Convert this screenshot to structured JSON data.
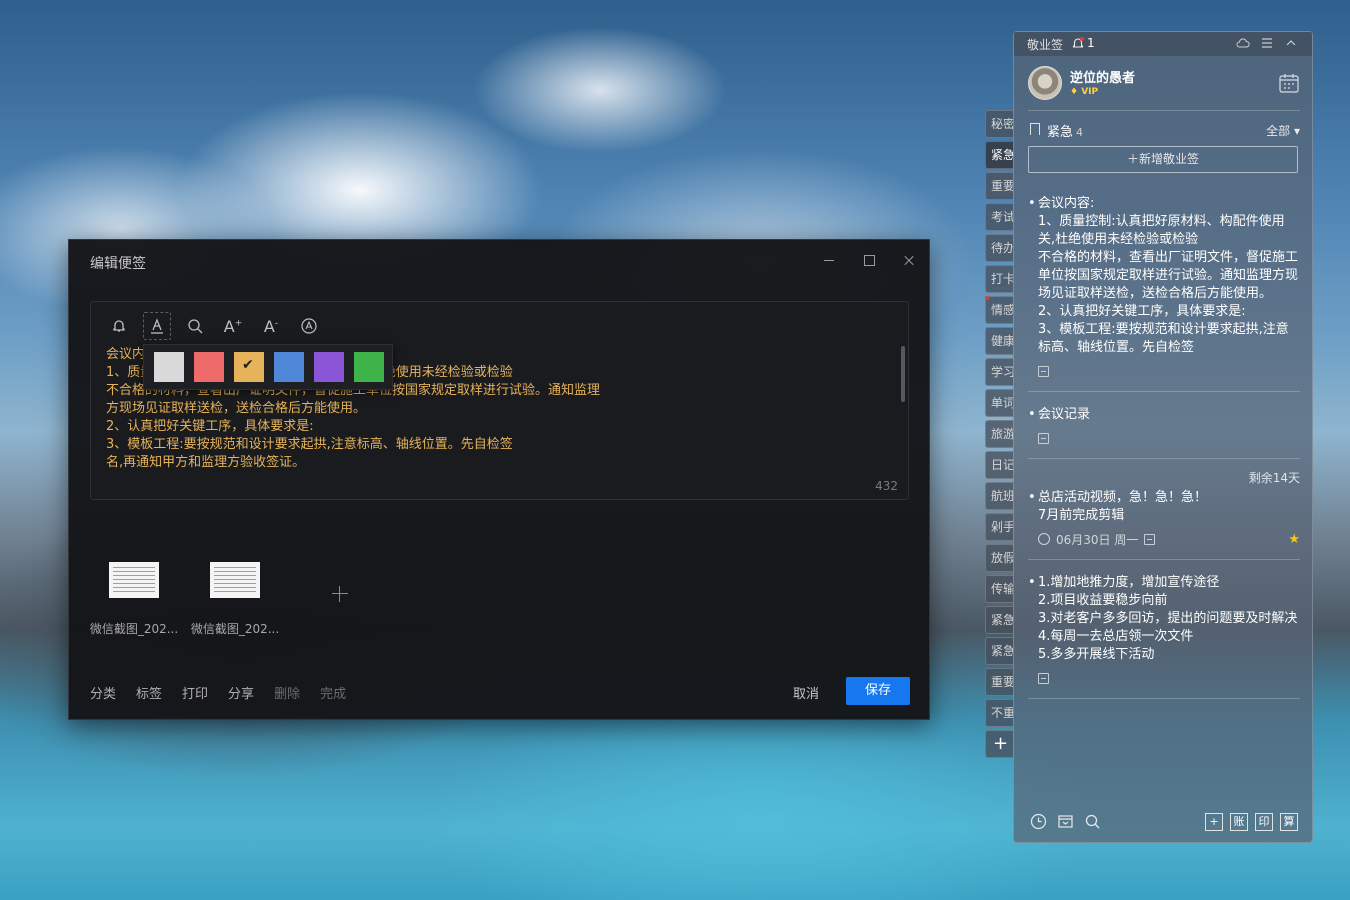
{
  "dialog": {
    "title": "编辑便签",
    "toolbar": [
      {
        "icon": "bell-icon"
      },
      {
        "icon": "text-color-icon"
      },
      {
        "icon": "search-icon"
      },
      {
        "icon": "font-increase-icon",
        "label": "A",
        "sup": "+"
      },
      {
        "icon": "font-decrease-icon",
        "label": "A",
        "sup": "-"
      },
      {
        "icon": "format-clear-icon"
      }
    ],
    "note_text": "会议内容:\n1、质量控制:认真把好原材料、构配件使用关,杜绝使用未经检验或检验\n不合格的材料，查看出厂证明文件，督促施工单位按国家规定取样进行试验。通知监理\n方现场见证取样送检，送检合格后方能使用。\n2、认真把好关键工序，具体要求是:\n3、模板工程:要按规范和设计要求起拱,注意标高、轴线位置。先自检签\n名,再通知甲方和监理方验收签证。",
    "text_color": "#e6b25a",
    "color_swatches": [
      "#d9d9d9",
      "#ef6a6a",
      "#e6b25a",
      "#4f88d8",
      "#8a55d6",
      "#3db34a"
    ],
    "selected_swatch": 2,
    "char_count": "432",
    "attachments": [
      {
        "name": "微信截图_202..."
      },
      {
        "name": "微信截图_202..."
      }
    ],
    "actions": {
      "category": "分类",
      "tag": "标签",
      "print": "打印",
      "share": "分享",
      "delete": "删除",
      "done": "完成"
    },
    "cancel_label": "取消",
    "save_label": "保存",
    "accent": "#1677ee"
  },
  "tabs": [
    "秘密",
    "紧急",
    "重要",
    "考试",
    "待办",
    "打卡",
    "情感",
    "健康",
    "学习",
    "单词",
    "旅游",
    "日记",
    "航班",
    "剁手",
    "放假",
    "传输",
    "紧急",
    "紧急",
    "重要",
    "不重"
  ],
  "active_tab": 1,
  "panel": {
    "app_name": "敬业签",
    "notification_count": "1",
    "user": {
      "name": "逆位的愚者",
      "badge": "VIP"
    },
    "category": {
      "name": "紧急",
      "count": "4"
    },
    "filter": "全部 ▾",
    "new_note_label": "＋新增敬业签",
    "notes": [
      {
        "body": "会议内容:\n1、质量控制:认真把好原材料、构配件使用关,杜绝使用未经检验或检验\n不合格的材料，查看出厂证明文件，督促施工单位按国家规定取样进行试验。通知监理方现场见证取样送检，送检合格后方能使用。\n2、认真把好关键工序，具体要求是:\n3、模板工程:要按规范和设计要求起拱,注意标高、轴线位置。先自检签",
        "remaining": "",
        "date": "",
        "starred": false
      },
      {
        "body": "会议记录",
        "remaining": "",
        "date": "",
        "starred": false
      },
      {
        "body": "总店活动视频，急！急！急！\n7月前完成剪辑",
        "remaining": "剩余14天",
        "date": "06月30日 周一",
        "starred": true
      },
      {
        "body": "1.增加地推力度，增加宣传途径\n2.项目收益要稳步向前\n3.对老客户多多回访，提出的问题要及时解决\n4.每周一去总店领一次文件\n5.多多开展线下活动",
        "remaining": "",
        "date": "",
        "starred": false
      }
    ],
    "footer_boxes": [
      "+",
      "账",
      "印",
      "算"
    ]
  }
}
